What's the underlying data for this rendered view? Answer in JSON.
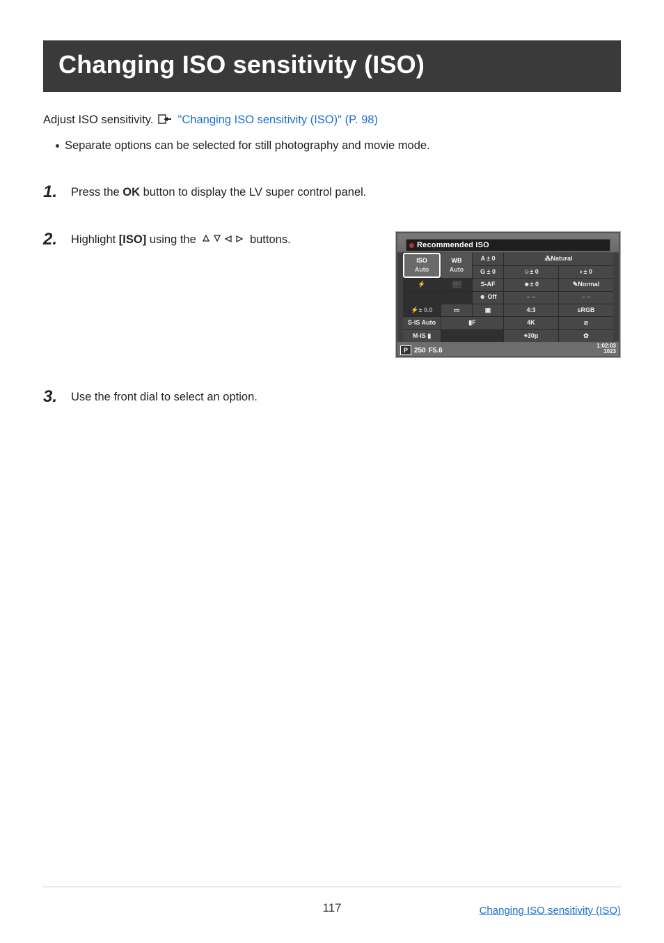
{
  "title": "Changing ISO sensitivity (ISO)",
  "intro": {
    "prefix": "Adjust ISO sensitivity.",
    "link_text": "\"Changing ISO sensitivity (ISO)\" (P. 98)"
  },
  "bullet": "Separate options can be selected for still photography and movie mode.",
  "steps": {
    "s1": {
      "num": "1",
      "t1": "Press the ",
      "bold": "OK",
      "t2": " button to display the LV super control panel."
    },
    "s2": {
      "num": "2",
      "t1": "Highlight ",
      "bold": "[ISO]",
      "t2": " using the ",
      "t3": " buttons."
    },
    "s3": {
      "num": "3",
      "text": "Use the front dial to select an option."
    }
  },
  "panel": {
    "header": "Recommended ISO",
    "iso_label": "ISO",
    "iso_value": "Auto",
    "wb_label": "WB",
    "wb_value": "Auto",
    "a": "A ± 0",
    "g": "G ± 0",
    "natural": "⁂Natural",
    "s0": "☺± 0",
    "c0": "◐± 0",
    "saf": "S-AF",
    "face0": "☻± 0",
    "normal": "✎Normal",
    "faceoff": "☻ Off",
    "dash1": "– –",
    "dash2": "– –",
    "flash": "⚡± 0.0",
    "drive": "▭",
    "area": "▣",
    "ratio": "4:3",
    "srgb": "sRGB",
    "sis": "S-IS Auto",
    "lf": "▮F",
    "fourk": "4K",
    "thirtyp": "⌖30p",
    "boxslash": "⧄",
    "mis": "M-IS ▮",
    "gear": "✿",
    "mode": "P",
    "shutter": "250",
    "aperture": "F5.6",
    "ftime": "1:02:03",
    "fcount": "1023"
  },
  "footer": {
    "page_number": "117",
    "link": "Changing ISO sensitivity (ISO)"
  }
}
